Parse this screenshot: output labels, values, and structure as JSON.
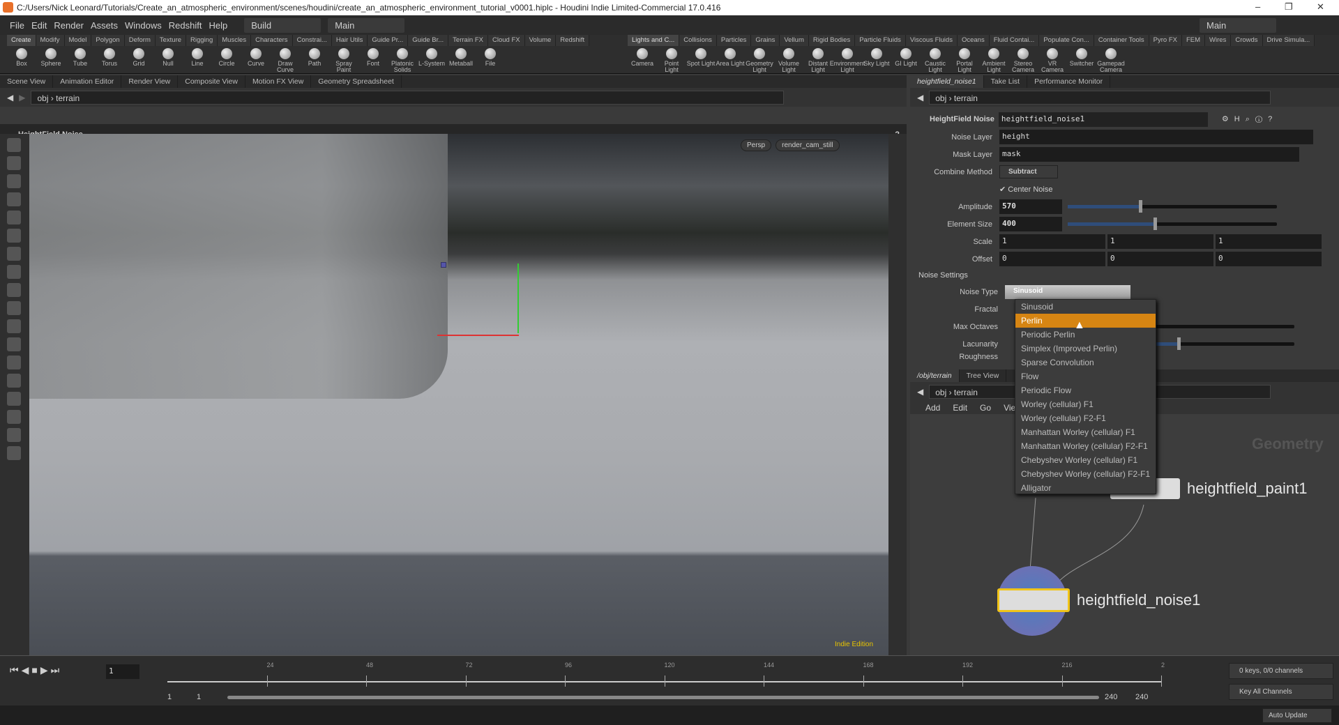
{
  "window": {
    "title": "C:/Users/Nick Leonard/Tutorials/Create_an_atmospheric_environment/scenes/houdini/create_an_atmospheric_environment_tutorial_v0001.hiplc - Houdini Indie Limited-Commercial 17.0.416",
    "minimize": "–",
    "maximize": "❐",
    "close": "✕"
  },
  "menu": {
    "items": [
      "File",
      "Edit",
      "Render",
      "Assets",
      "Windows",
      "Redshift",
      "Help"
    ],
    "desktop": "Build",
    "desktop2": "Main",
    "right_desktop": "Main"
  },
  "shelf_left": {
    "tabs": [
      "Create",
      "Modify",
      "Model",
      "Polygon",
      "Deform",
      "Texture",
      "Rigging",
      "Muscles",
      "Characters",
      "Constrai...",
      "Hair Utils",
      "Guide Pr...",
      "Guide Br...",
      "Terrain FX",
      "Cloud FX",
      "Volume",
      "Redshift"
    ],
    "tools": [
      "Box",
      "Sphere",
      "Tube",
      "Torus",
      "Grid",
      "Null",
      "Line",
      "Circle",
      "Curve",
      "Draw Curve",
      "Path",
      "Spray Paint",
      "Font",
      "Platonic Solids",
      "L-System",
      "Metaball",
      "File"
    ]
  },
  "shelf_right": {
    "tabs": [
      "Lights and C...",
      "Collisions",
      "Particles",
      "Grains",
      "Vellum",
      "Rigid Bodies",
      "Particle Fluids",
      "Viscous Fluids",
      "Oceans",
      "Fluid Contai...",
      "Populate Con...",
      "Container Tools",
      "Pyro FX",
      "FEM",
      "Wires",
      "Crowds",
      "Drive Simula..."
    ],
    "tools": [
      "Camera",
      "Point Light",
      "Spot Light",
      "Area Light",
      "Geometry Light",
      "Volume Light",
      "Distant Light",
      "Environment Light",
      "Sky Light",
      "GI Light",
      "Caustic Light",
      "Portal Light",
      "Ambient Light",
      "Stereo Camera",
      "VR Camera",
      "Switcher",
      "Gamepad Camera"
    ]
  },
  "left_pane": {
    "tabs": [
      "Scene View",
      "Animation Editor",
      "Render View",
      "Composite View",
      "Motion FX View",
      "Geometry Spreadsheet"
    ],
    "path": [
      "obj",
      "terrain"
    ],
    "op_label": "HeightField Noise",
    "view": "Persp",
    "camera": "render_cam_still",
    "edition": "Indie Edition"
  },
  "param_pane": {
    "tabs": [
      "heightfield_noise1",
      "Take List",
      "Performance Monitor"
    ],
    "path": [
      "obj",
      "terrain"
    ],
    "node_type": "HeightField Noise",
    "node_name": "heightfield_noise1",
    "noise_layer_label": "Noise Layer",
    "noise_layer": "height",
    "mask_layer_label": "Mask Layer",
    "mask_layer": "mask",
    "combine_label": "Combine Method",
    "combine": "Subtract",
    "center_noise_label": "Center Noise",
    "center_noise": true,
    "amplitude_label": "Amplitude",
    "amplitude": "570",
    "amplitude_slider": 0.34,
    "element_size_label": "Element Size",
    "element_size": "400",
    "element_size_slider": 0.41,
    "scale_label": "Scale",
    "scale": [
      "1",
      "1",
      "1"
    ],
    "offset_label": "Offset",
    "offset": [
      "0",
      "0",
      "0"
    ],
    "noise_settings": "Noise Settings",
    "noise_type_label": "Noise Type",
    "noise_type": "Sinusoid",
    "fractal_label": "Fractal",
    "max_octaves_label": "Max Octaves",
    "lacunarity_label": "Lacunarity",
    "roughness_label": "Roughness"
  },
  "noise_type_options": [
    "Sinusoid",
    "Perlin",
    "Periodic Perlin",
    "Simplex (Improved Perlin)",
    "Sparse Convolution",
    "Flow",
    "Periodic Flow",
    "Worley (cellular) F1",
    "Worley (cellular) F2-F1",
    "Manhattan Worley (cellular) F1",
    "Manhattan Worley (cellular) F2-F1",
    "Chebyshev Worley (cellular) F1",
    "Chebyshev Worley (cellular) F2-F1",
    "Alligator"
  ],
  "noise_type_highlighted": "Perlin",
  "network": {
    "tabs": [
      "/obj/terrain",
      "Tree View"
    ],
    "path": [
      "obj",
      "terrain"
    ],
    "menu": [
      "Add",
      "Edit",
      "Go",
      "View"
    ],
    "context": "Geometry",
    "nodes": [
      "heightfield_paint1",
      "heightfield_noise1"
    ]
  },
  "timeline": {
    "frame": "1",
    "ticks": [
      "24",
      "48",
      "72",
      "96",
      "120",
      "144",
      "168",
      "192",
      "216",
      "2"
    ],
    "start": "1",
    "start2": "1",
    "end": "240",
    "end2": "240",
    "keys": "0 keys, 0/0 channels",
    "key_all": "Key All Channels",
    "auto_update": "Auto Update"
  }
}
